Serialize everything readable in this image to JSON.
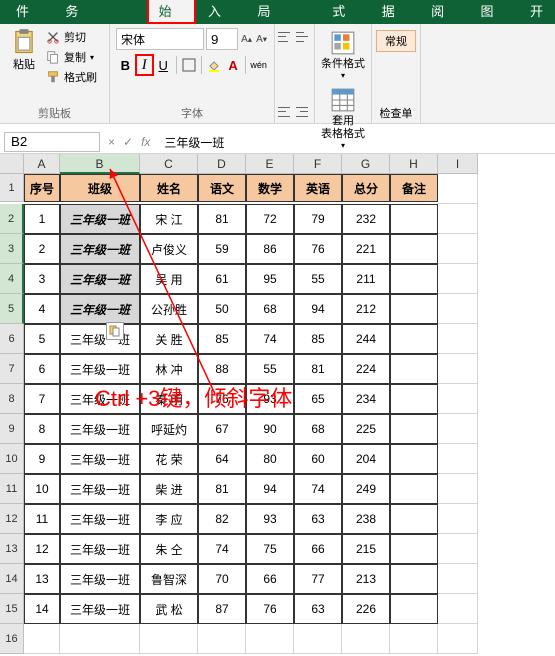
{
  "tabs": {
    "file": "文件",
    "custom": "Excel与财务",
    "home": "开始",
    "insert": "插入",
    "layout": "页面布局",
    "formula": "公式",
    "data": "数据",
    "review": "审阅",
    "view": "视图",
    "dev": "开"
  },
  "clipboard": {
    "paste": "粘贴",
    "cut": "剪切",
    "copy": "复制",
    "painter": "格式刷",
    "group": "剪贴板"
  },
  "font": {
    "name": "宋体",
    "size": "9",
    "bold": "B",
    "italic": "I",
    "underline": "U",
    "wen": "wén",
    "group": "字体"
  },
  "styles": {
    "cond": "条件格式",
    "table": "套用\n表格格式",
    "normal": "常规",
    "check": "检查单"
  },
  "namebox": "B2",
  "formula_value": "三年级一班",
  "col_labels": [
    "A",
    "B",
    "C",
    "D",
    "E",
    "F",
    "G",
    "H",
    "I"
  ],
  "headers": [
    "序号",
    "班级",
    "姓名",
    "语文",
    "数学",
    "英语",
    "总分",
    "备注"
  ],
  "data_rows": [
    [
      "1",
      "三年级一班",
      "宋  江",
      "81",
      "72",
      "79",
      "232",
      ""
    ],
    [
      "2",
      "三年级一班",
      "卢俊义",
      "59",
      "86",
      "76",
      "221",
      ""
    ],
    [
      "3",
      "三年级一班",
      "吴  用",
      "61",
      "95",
      "55",
      "211",
      ""
    ],
    [
      "4",
      "三年级一班",
      "公孙胜",
      "50",
      "68",
      "94",
      "212",
      ""
    ],
    [
      "5",
      "三年级一班",
      "关  胜",
      "85",
      "74",
      "85",
      "244",
      ""
    ],
    [
      "6",
      "三年级一班",
      "林  冲",
      "88",
      "55",
      "81",
      "224",
      ""
    ],
    [
      "7",
      "三年级一班",
      "秦  明",
      "76",
      "93",
      "65",
      "234",
      ""
    ],
    [
      "8",
      "三年级一班",
      "呼延灼",
      "67",
      "90",
      "68",
      "225",
      ""
    ],
    [
      "9",
      "三年级一班",
      "花  荣",
      "64",
      "80",
      "60",
      "204",
      ""
    ],
    [
      "10",
      "三年级一班",
      "柴  进",
      "81",
      "94",
      "74",
      "249",
      ""
    ],
    [
      "11",
      "三年级一班",
      "李  应",
      "82",
      "93",
      "63",
      "238",
      ""
    ],
    [
      "12",
      "三年级一班",
      "朱  仝",
      "74",
      "75",
      "66",
      "215",
      ""
    ],
    [
      "13",
      "三年级一班",
      "鲁智深",
      "70",
      "66",
      "77",
      "213",
      ""
    ],
    [
      "14",
      "三年级一班",
      "武  松",
      "87",
      "76",
      "63",
      "226",
      ""
    ]
  ],
  "annotation": "Ctrl +3键，倾斜字体",
  "selected_rows": [
    0,
    1,
    2,
    3
  ]
}
